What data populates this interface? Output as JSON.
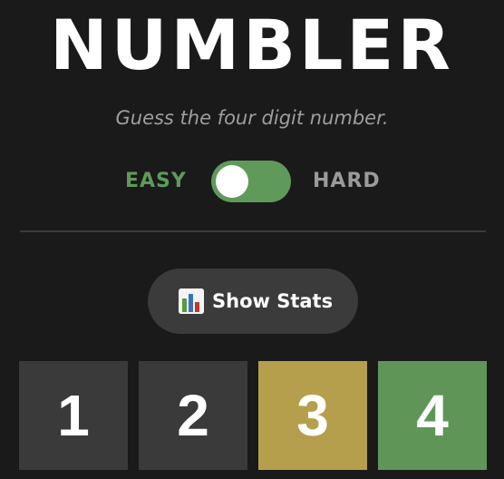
{
  "header": {
    "title": "NUMBLER",
    "subtitle": "Guess the four digit number."
  },
  "mode_toggle": {
    "easy_label": "EASY",
    "hard_label": "HARD",
    "selected": "EASY",
    "colors": {
      "easy_active": "#5f9a5b",
      "hard_inactive": "#9b9b9b",
      "track": "#5f9a5b",
      "knob": "#ffffff"
    }
  },
  "stats_button": {
    "icon": "bar-chart-icon",
    "label": "Show Stats"
  },
  "guess_tiles": [
    {
      "digit": "1",
      "state": "absent",
      "color": "#3a3a3a"
    },
    {
      "digit": "2",
      "state": "absent",
      "color": "#3a3a3a"
    },
    {
      "digit": "3",
      "state": "present",
      "color": "#b59f4c"
    },
    {
      "digit": "4",
      "state": "correct",
      "color": "#5f9658"
    }
  ]
}
